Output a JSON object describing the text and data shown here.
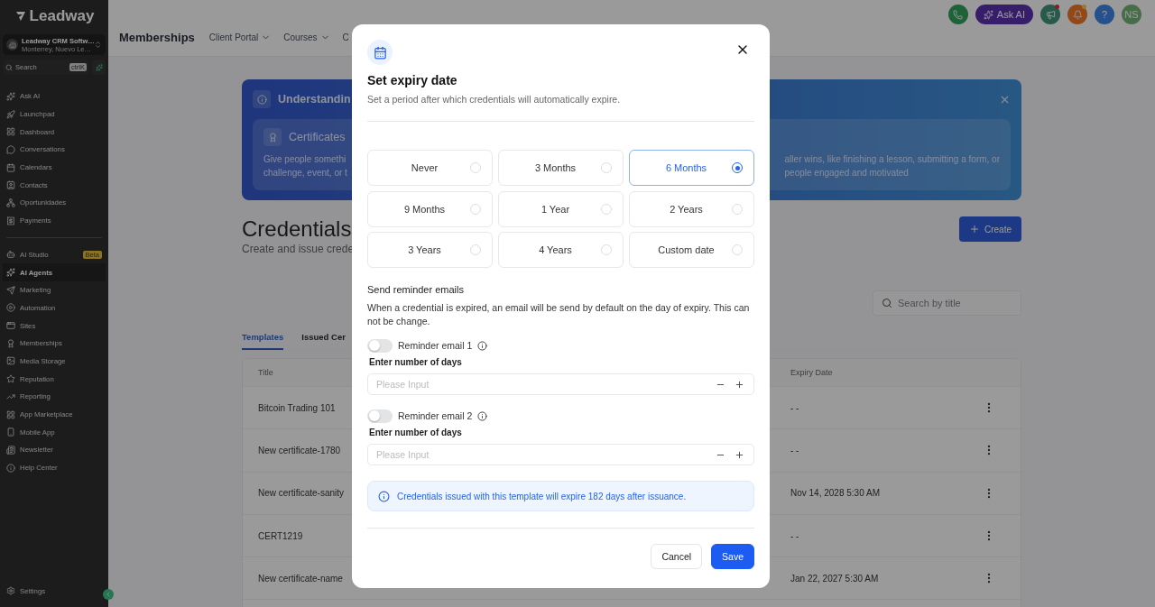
{
  "sidebar": {
    "logo": "Leadway",
    "account": {
      "name": "Leadway CRM Softw…",
      "location": "Monterrey, Nuevo Le…"
    },
    "search": {
      "placeholder": "Search",
      "shortcut": "ctrlK"
    },
    "groups": [
      [
        {
          "label": "Ask AI",
          "selected": false
        },
        {
          "label": "Launchpad",
          "selected": false
        },
        {
          "label": "Dashboard",
          "selected": false
        },
        {
          "label": "Conversations",
          "selected": false
        },
        {
          "label": "Calendars",
          "selected": false
        },
        {
          "label": "Contacts",
          "selected": false
        },
        {
          "label": "Oportunidades",
          "selected": false
        },
        {
          "label": "Payments",
          "selected": false
        }
      ],
      [
        {
          "label": "AI Studio",
          "badge": "Beta",
          "selected": false
        },
        {
          "label": "AI Agents",
          "selected": true
        },
        {
          "label": "Marketing",
          "selected": false
        },
        {
          "label": "Automation",
          "selected": false
        },
        {
          "label": "Sites",
          "selected": false
        },
        {
          "label": "Memberships",
          "selected": false
        },
        {
          "label": "Media Storage",
          "selected": false
        },
        {
          "label": "Reputation",
          "selected": false
        },
        {
          "label": "Reporting",
          "selected": false
        },
        {
          "label": "App Marketplace",
          "selected": false
        },
        {
          "label": "Mobile App",
          "selected": false
        },
        {
          "label": "Newsletter",
          "selected": false
        },
        {
          "label": "Help Center",
          "selected": false
        }
      ]
    ],
    "settings": "Settings"
  },
  "header": {
    "title": "Memberships",
    "nav": [
      {
        "label": "Client Portal",
        "has_menu": true
      },
      {
        "label": "Courses",
        "has_menu": true
      },
      {
        "label": "C",
        "has_menu": false
      }
    ],
    "actions": {
      "ask_ai": "Ask AI",
      "help": "?",
      "avatar": "NS"
    }
  },
  "banner": {
    "title": "Understandin",
    "card_title": "Certificates",
    "left_lines": [
      "Give people somethi",
      "challenge, event, or t"
    ],
    "right_lines": [
      "aller wins, like finishing a lesson, submitting a form, or",
      "people engaged and motivated"
    ]
  },
  "page": {
    "title": "Credentials",
    "subtitle": "Create and issue crede",
    "create": "Create",
    "search_placeholder": "Search by title",
    "tabs": [
      {
        "label": "Templates",
        "selected": true
      },
      {
        "label": "Issued Cer",
        "selected": false
      }
    ],
    "columns": [
      "Title",
      "Expiry Date"
    ],
    "rows": [
      {
        "title": "Bitcoin Trading 101",
        "expiry": "- -"
      },
      {
        "title": "New certificate-1780",
        "expiry": "- -"
      },
      {
        "title": "New certificate-sanity",
        "expiry": "Nov 14, 2028 5:30 AM"
      },
      {
        "title": "CERT1219",
        "expiry": "- -"
      },
      {
        "title": "New certificate-name",
        "expiry": "Jan 22, 2027 5:30 AM"
      }
    ]
  },
  "modal": {
    "title": "Set expiry date",
    "subtitle": "Set a period after which credentials will automatically expire.",
    "options": [
      {
        "label": "Never",
        "selected": false
      },
      {
        "label": "3 Months",
        "selected": false
      },
      {
        "label": "6 Months",
        "selected": true
      },
      {
        "label": "9 Months",
        "selected": false
      },
      {
        "label": "1 Year",
        "selected": false
      },
      {
        "label": "2 Years",
        "selected": false
      },
      {
        "label": "3 Years",
        "selected": false
      },
      {
        "label": "4 Years",
        "selected": false
      },
      {
        "label": "Custom date",
        "selected": false
      }
    ],
    "reminder_heading": "Send reminder emails",
    "reminder_note": "When a credential is expired, an email will be send by default on the day of expiry. This can not be change.",
    "reminders": [
      {
        "label": "Reminder email 1",
        "on": false,
        "field_label": "Enter number of days",
        "placeholder": "Please Input"
      },
      {
        "label": "Reminder email 2",
        "on": false,
        "field_label": "Enter number of days",
        "placeholder": "Please Input"
      }
    ],
    "notice": "Credentials issued with this template will expire 182 days after issuance.",
    "cancel": "Cancel",
    "save": "Save"
  }
}
